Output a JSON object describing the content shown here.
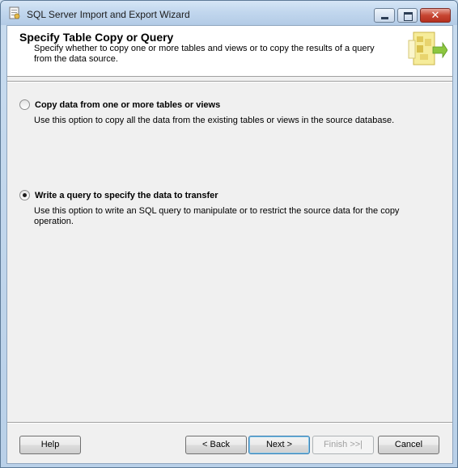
{
  "window": {
    "title": "SQL Server Import and Export Wizard",
    "controls": {
      "minimize": "minimize",
      "maximize": "maximize",
      "close": "✕"
    }
  },
  "header": {
    "title": "Specify Table Copy or Query",
    "description": "Specify whether to copy one or more tables and views or to copy the results of a query from the data source."
  },
  "options": [
    {
      "label": "Copy data from one or more tables or views",
      "description": "Use this option to copy all the data from the existing tables or views in the source database.",
      "selected": false
    },
    {
      "label": "Write a query to specify the data to transfer",
      "description": "Use this option to write an SQL query to manipulate or to restrict the source data for the copy operation.",
      "selected": true
    }
  ],
  "buttons": {
    "help": "Help",
    "back": "< Back",
    "next": "Next >",
    "finish": "Finish >>|",
    "cancel": "Cancel"
  }
}
